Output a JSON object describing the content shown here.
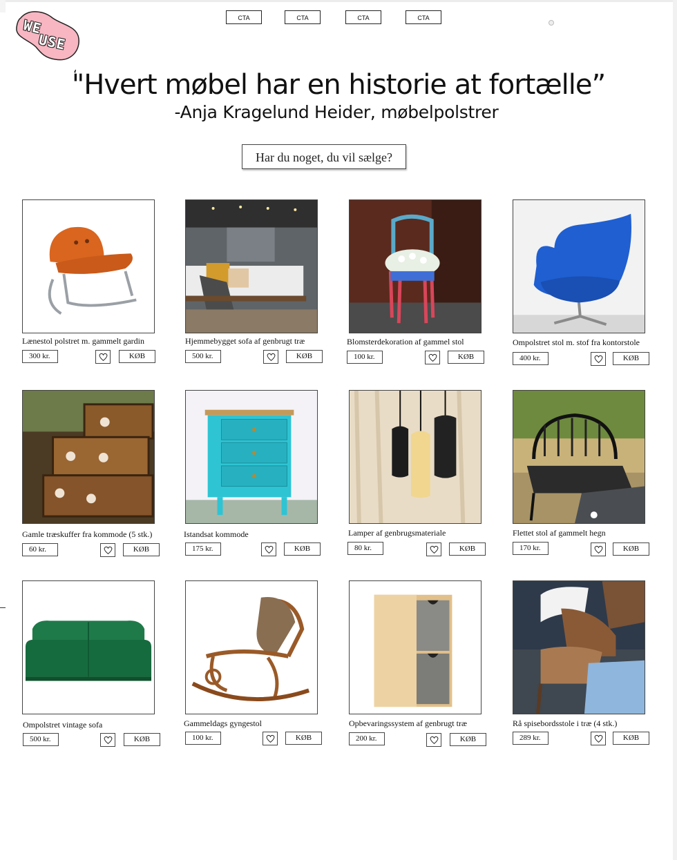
{
  "brand": {
    "logo_text": "WE USE",
    "logo_line1": "WE",
    "logo_line2": "USE",
    "logo_color": "#f7b6c2"
  },
  "nav": {
    "cta_labels": [
      "CTA",
      "CTA",
      "CTA",
      "CTA"
    ]
  },
  "hero": {
    "quote_mark": "‘",
    "quote": "\"Hvert møbel har en historie at fortælle”",
    "author": "-Anja Kragelund Heider, møbelpolstrer"
  },
  "sell_button_label": "Har du noget, du vil sælge?",
  "colors": {
    "border": "#444444",
    "text": "#111111",
    "background": "#ffffff"
  },
  "products": [
    {
      "title": "Lænestol polstret m. gammelt gardin",
      "price": "300 kr.",
      "buy_label": "KØB",
      "icon": "heart-icon"
    },
    {
      "title": "Hjemmebygget sofa af genbrugt træ",
      "price": "500 kr.",
      "buy_label": "KØB",
      "icon": "heart-icon"
    },
    {
      "title": "Blomsterdekoration af gammel stol",
      "price": "100 kr.",
      "buy_label": "KØB",
      "icon": "heart-icon"
    },
    {
      "title": "Ompolstret stol m. stof fra kontorstole",
      "price": "400 kr.",
      "buy_label": "KØB",
      "icon": "heart-icon"
    },
    {
      "title": "Gamle træskuffer fra kommode (5 stk.)",
      "price": "60 kr.",
      "buy_label": "KØB",
      "icon": "heart-icon"
    },
    {
      "title": "Istandsat kommode",
      "price": "175 kr.",
      "buy_label": "KØB",
      "icon": "heart-icon"
    },
    {
      "title": "Lamper af genbrugsmateriale",
      "price": "80 kr.",
      "buy_label": "KØB",
      "icon": "heart-icon"
    },
    {
      "title": "Flettet stol af gammelt hegn",
      "price": "170 kr.",
      "buy_label": "KØB",
      "icon": "heart-icon"
    },
    {
      "title": "Ompolstret vintage sofa",
      "price": "500 kr.",
      "buy_label": "KØB",
      "icon": "heart-icon"
    },
    {
      "title": "Gammeldags gyngestol",
      "price": "100 kr.",
      "buy_label": "KØB",
      "icon": "heart-icon"
    },
    {
      "title": "Opbevaringssystem af genbrugt træ",
      "price": "200 kr.",
      "buy_label": "KØB",
      "icon": "heart-icon"
    },
    {
      "title": "Rå spisebordsstole i træ (4 stk.)",
      "price": "289 kr.",
      "buy_label": "KØB",
      "icon": "heart-icon"
    }
  ]
}
